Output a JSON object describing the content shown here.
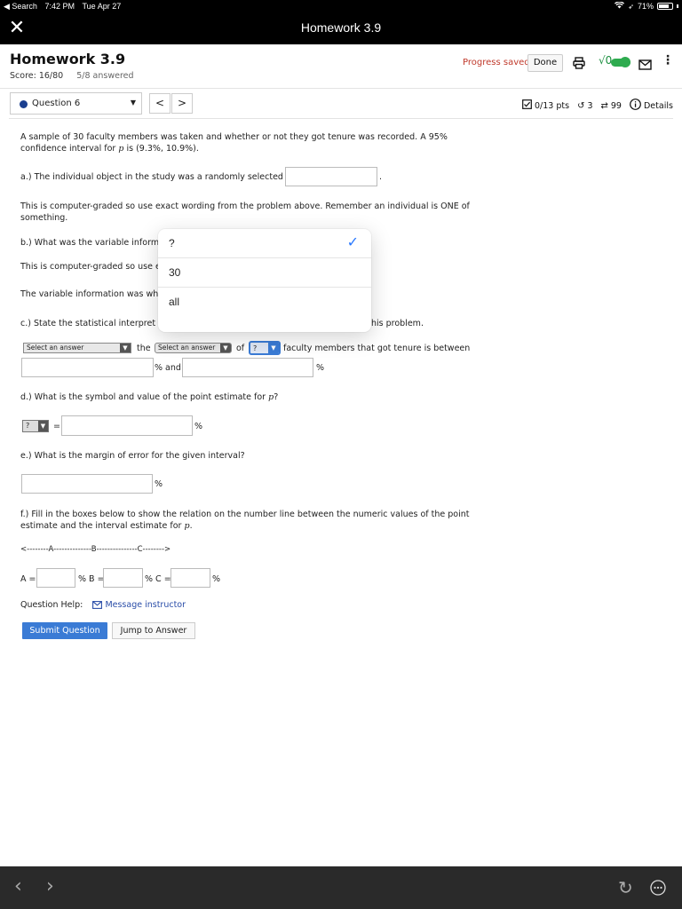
{
  "status_bar": {
    "back_app": "◀ Search",
    "time": "7:42 PM",
    "date": "Tue Apr 27",
    "battery": "71%"
  },
  "nav": {
    "title": "Homework 3.9",
    "close_icon": "close-icon"
  },
  "header": {
    "title": "Homework 3.9",
    "score": "Score: 16/80",
    "answered": "5/8 answered",
    "progress_saved": "Progress saved",
    "done_label": "Done",
    "sqrt_label": "√0"
  },
  "question_nav": {
    "selected": "Question 6",
    "prev": "<",
    "next": ">"
  },
  "question_meta": {
    "points": "0/13 pts",
    "retries": "3",
    "attempts": "99",
    "details": "Details"
  },
  "question": {
    "intro_line1": "A sample of 30 faculty members was taken and whether or not they got tenure was recorded. A 95%",
    "intro_line2_pre": "confidence interval for ",
    "intro_line2_var": "p",
    "intro_line2_post": " is (9.3%, 10.9%).",
    "part_a": "a.) The individual object in the study was a randomly selected",
    "part_a_end": ".",
    "note_a_line1": "This is computer-graded so use exact wording from the problem above. Remember an individual is ONE of",
    "note_a_line2": "something.",
    "part_b": "b.) What was the variable inform",
    "note_b": "This is computer-graded so use e",
    "variable_info": "The variable information was wh",
    "part_c": "c.) State the statistical interpret",
    "part_c_end": "his problem.",
    "select_answer_1": "Select an answer",
    "the_label": "the",
    "select_answer_2": "Select an answer",
    "of_label": "of",
    "small_select": "?",
    "faculty_text": "faculty members that got tenure is between",
    "pct_and": "% and",
    "pct": "%",
    "part_d_pre": "d.) What is the symbol and value of the point estimate for ",
    "part_d_var": "p",
    "part_d_post": "?",
    "symbol_select": "?",
    "equals": "=",
    "part_e": "e.) What is the margin of error for the given interval?",
    "part_f_line1": "f.) Fill in the boxes below to show the relation on the number line between the numeric values of the point",
    "part_f_line2_pre": "estimate and the interval estimate for ",
    "part_f_line2_var": "p",
    "part_f_line2_post": ".",
    "number_line": "<--------A--------------B---------------C-------->",
    "a_label": "A =",
    "pct_b_label": "% B =",
    "pct_c_label": "% C =",
    "help_label": "Question Help:",
    "message_instructor": "Message instructor",
    "submit": "Submit Question",
    "jump": "Jump to Answer"
  },
  "popup": {
    "options": [
      "?",
      "30",
      "all"
    ],
    "selected_index": 0
  },
  "colors": {
    "accent_blue": "#3a7bd5",
    "progress_red": "#c0392b",
    "check_blue": "#2979ff",
    "toggle_green": "#2eab4f"
  }
}
